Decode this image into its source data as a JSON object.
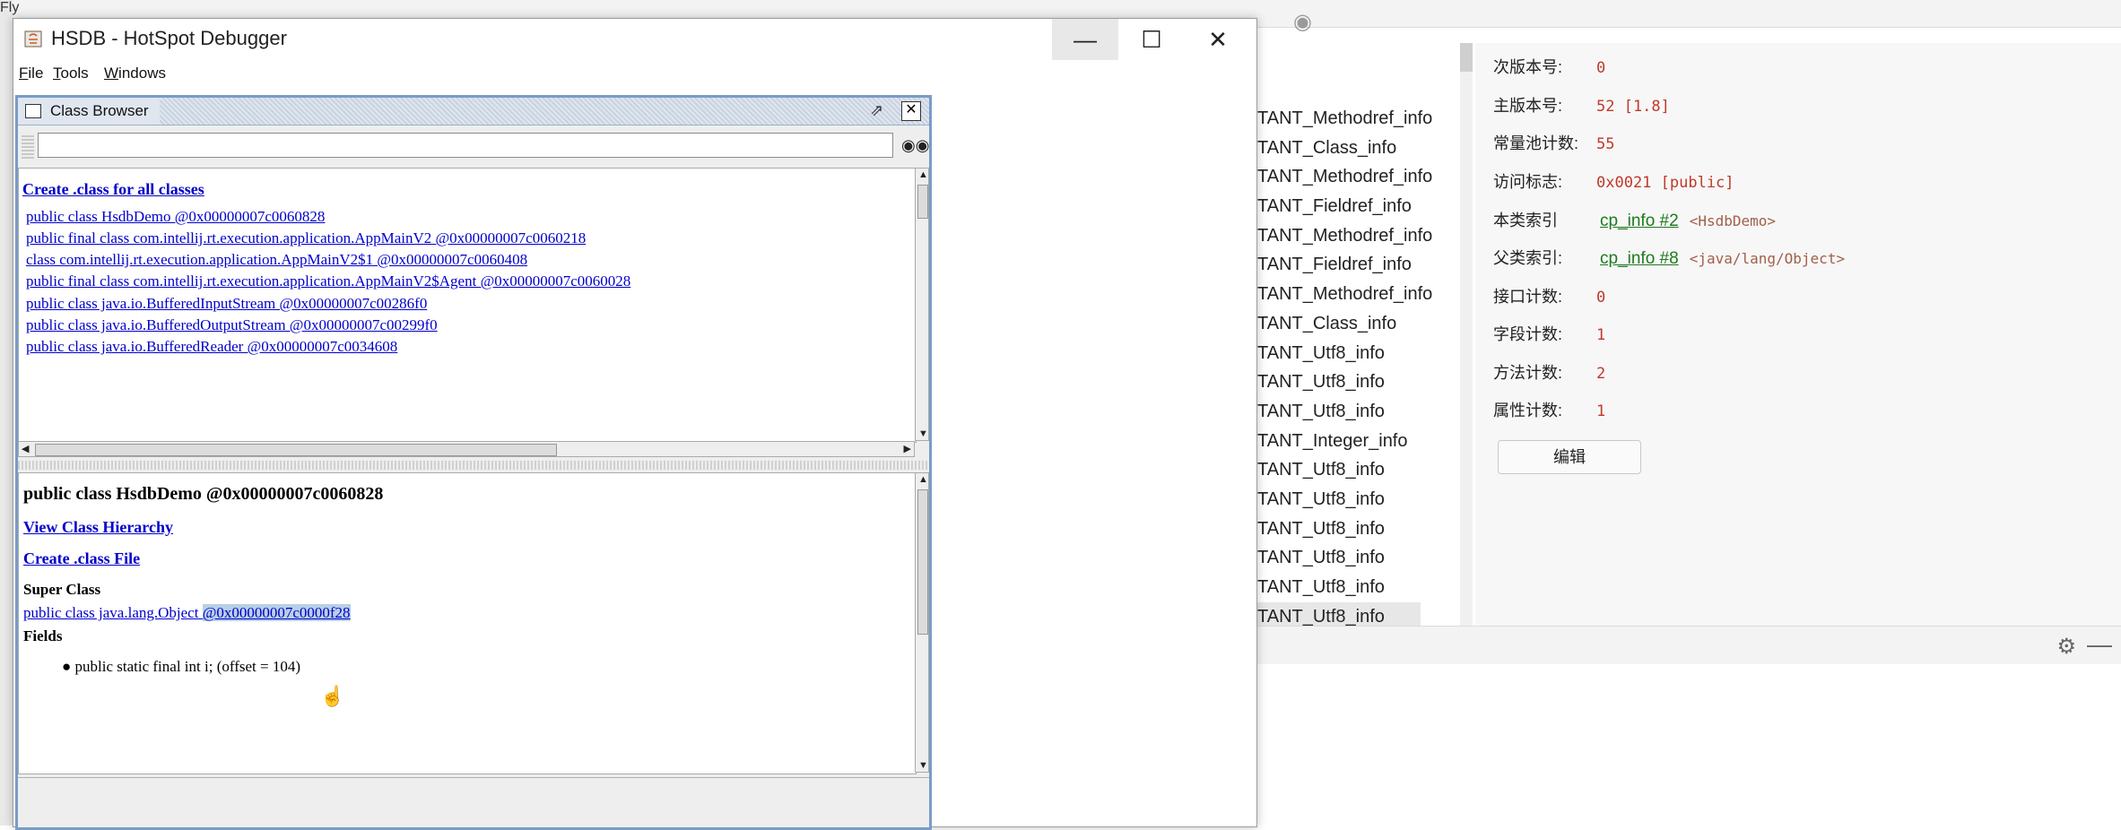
{
  "background": {
    "top_tab_text": "Fly",
    "constant_items": [
      "TANT_Methodref_info",
      "TANT_Class_info",
      "TANT_Methodref_info",
      "TANT_Fieldref_info",
      "TANT_Methodref_info",
      "TANT_Fieldref_info",
      "TANT_Methodref_info",
      "TANT_Class_info",
      "TANT_Utf8_info",
      "TANT_Utf8_info",
      "TANT_Utf8_info",
      "TANT_Integer_info",
      "TANT_Utf8_info",
      "TANT_Utf8_info",
      "TANT_Utf8_info",
      "TANT_Utf8_info",
      "TANT_Utf8_info",
      "TANT_Utf8_info"
    ],
    "info": {
      "minor_label": "次版本号:",
      "minor_value": "0",
      "major_label": "主版本号:",
      "major_value": "52 [1.8]",
      "cp_count_label": "常量池计数:",
      "cp_count_value": "55",
      "access_label": "访问标志:",
      "access_value": "0x0021 [public]",
      "this_label": "本类索引",
      "this_link": "cp_info #2",
      "this_extra": "<HsdbDemo>",
      "super_label": "父类索引:",
      "super_link": "cp_info #8",
      "super_extra": "<java/lang/Object>",
      "iface_label": "接口计数:",
      "iface_value": "0",
      "field_label": "字段计数:",
      "field_value": "1",
      "method_label": "方法计数:",
      "method_value": "2",
      "attr_label": "属性计数:",
      "attr_value": "1",
      "edit_button": "编辑"
    }
  },
  "window": {
    "title": "HSDB - HotSpot Debugger",
    "menus": [
      "File",
      "Tools",
      "Windows"
    ]
  },
  "class_browser": {
    "title": "Class Browser",
    "search_value": "",
    "create_all_link": "Create .class for all classes",
    "classes": [
      "public class HsdbDemo @0x00000007c0060828",
      "public final class com.intellij.rt.execution.application.AppMainV2 @0x00000007c0060218",
      "class com.intellij.rt.execution.application.AppMainV2$1 @0x00000007c0060408",
      "public final class com.intellij.rt.execution.application.AppMainV2$Agent @0x00000007c0060028",
      "public class java.io.BufferedInputStream @0x00000007c00286f0",
      "public class java.io.BufferedOutputStream @0x00000007c00299f0",
      "public class java.io.BufferedReader @0x00000007c0034608"
    ],
    "detail": {
      "class_heading": "public class HsdbDemo @0x00000007c0060828",
      "view_hierarchy": "View Class Hierarchy",
      "create_file": "Create .class File",
      "super_heading": "Super Class",
      "super_link_a": "public class java.lang.Object ",
      "super_link_b": "@0x00000007c0000f28",
      "fields_heading": "Fields",
      "field_1": "public static final int i; (offset = 104)"
    }
  }
}
